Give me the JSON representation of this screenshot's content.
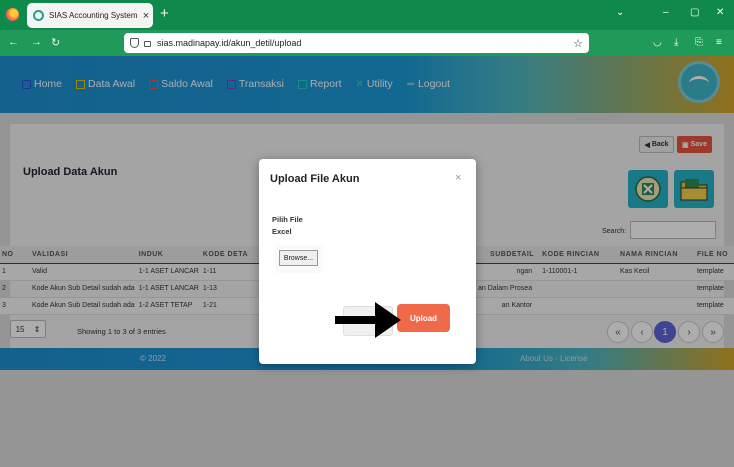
{
  "browser": {
    "tab_title": "SIAS Accounting System",
    "tab_close": "×",
    "new_tab": "+",
    "url": "sias.madinapay.id/akun_detil/upload",
    "controls": {
      "chevron": "⌄",
      "minimize": "–",
      "maximize": "▢",
      "close": "✕"
    }
  },
  "nav": {
    "items": [
      {
        "label": "Home",
        "icon": "home-icon",
        "color": "#2b4fd8"
      },
      {
        "label": "Data Awal",
        "icon": "monitor-icon",
        "color": "#e9c21f"
      },
      {
        "label": "Saldo Awal",
        "icon": "edit-icon",
        "color": "#e25b5b"
      },
      {
        "label": "Transaksi",
        "icon": "grid-icon",
        "color": "#7d3fc9"
      },
      {
        "label": "Report",
        "icon": "monitor-icon",
        "color": "#1fd0c6"
      },
      {
        "label": "Utility",
        "icon": "tools-icon",
        "color": "#2fd6c8"
      },
      {
        "label": "Logout",
        "icon": "signout-icon",
        "color": "#8fc0e0"
      }
    ]
  },
  "page": {
    "title": "Upload Data Akun",
    "back_label": "Back",
    "save_label": "Save",
    "search_label": "Search:"
  },
  "table": {
    "headers": [
      "NO",
      "VALIDASI",
      "INDUK",
      "KODE DETA",
      "SUBDETAIL",
      "KODE RINCIAN",
      "NAMA RINCIAN",
      "FILE NO"
    ],
    "rows": [
      {
        "no": "1",
        "validasi": "Valid",
        "status": "valid",
        "induk": "1-1 ASET LANCAR",
        "kode_detail": "1-11",
        "subdetail": "ngan",
        "kode_rincian": "1-110001-1",
        "nama_rincian": "Kas Kecil",
        "file": "template"
      },
      {
        "no": "2",
        "validasi": "Kode Akun Sub Detail sudah ada",
        "status": "invalid",
        "induk": "1-1 ASET LANCAR",
        "kode_detail": "1-13",
        "subdetail": "an Dalam Prosea",
        "kode_rincian": "",
        "nama_rincian": "",
        "file": "template"
      },
      {
        "no": "3",
        "validasi": "Kode Akun Sub Detail sudah ada",
        "status": "invalid",
        "induk": "1-2 ASET TETAP",
        "kode_detail": "1-21",
        "subdetail": "an Kantor",
        "kode_rincian": "",
        "nama_rincian": "",
        "file": "template"
      }
    ]
  },
  "footer_controls": {
    "page_size": "15",
    "showing": "Showing 1 to 3 of 3 entries",
    "pagination": [
      "«",
      "‹",
      "1",
      "›",
      "»"
    ],
    "active_page": "1"
  },
  "footer": {
    "copyright": "© 2022",
    "links": "About Us · License"
  },
  "modal": {
    "title": "Upload File Akun",
    "close": "×",
    "label": "Pilih File Excel",
    "browse_label": "Browse...",
    "close_label": "Cl",
    "upload_label": "Upload"
  }
}
